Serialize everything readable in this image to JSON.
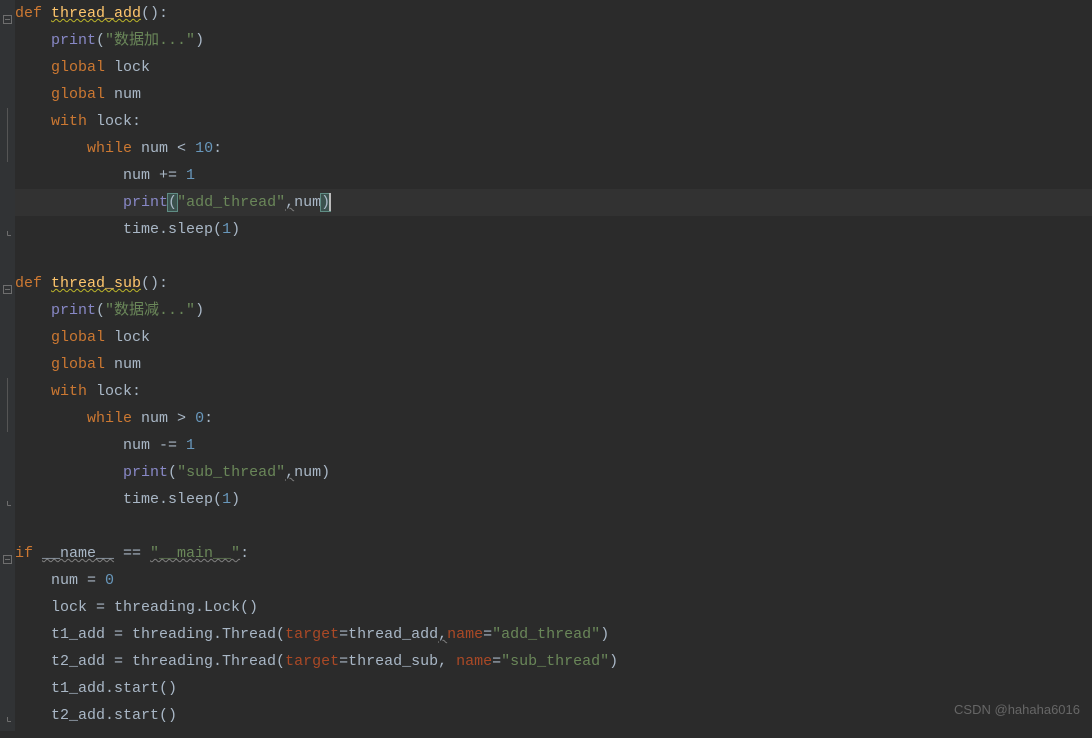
{
  "code": {
    "lines": [
      {
        "type": "def_start",
        "tokens": [
          {
            "t": "def ",
            "c": "kw"
          },
          {
            "t": "thread_add",
            "c": "fn wavy-fn"
          },
          {
            "t": "():",
            "c": "punct"
          }
        ]
      },
      {
        "indent": 1,
        "tokens": [
          {
            "t": "print",
            "c": "builtin"
          },
          {
            "t": "(",
            "c": "punct"
          },
          {
            "t": "\"数据加...\"",
            "c": "str"
          },
          {
            "t": ")",
            "c": "punct"
          }
        ]
      },
      {
        "indent": 1,
        "tokens": [
          {
            "t": "global ",
            "c": "kw"
          },
          {
            "t": "lock",
            "c": "ident"
          }
        ]
      },
      {
        "indent": 1,
        "tokens": [
          {
            "t": "global ",
            "c": "kw"
          },
          {
            "t": "num",
            "c": "ident"
          }
        ]
      },
      {
        "indent": 1,
        "tokens": [
          {
            "t": "with ",
            "c": "kw"
          },
          {
            "t": "lock:",
            "c": "ident"
          }
        ]
      },
      {
        "indent": 2,
        "tokens": [
          {
            "t": "while ",
            "c": "kw"
          },
          {
            "t": "num ",
            "c": "ident"
          },
          {
            "t": "< ",
            "c": "punct"
          },
          {
            "t": "10",
            "c": "num"
          },
          {
            "t": ":",
            "c": "punct"
          }
        ]
      },
      {
        "indent": 3,
        "tokens": [
          {
            "t": "num += ",
            "c": "ident"
          },
          {
            "t": "1",
            "c": "num"
          }
        ]
      },
      {
        "indent": 3,
        "highlight": true,
        "tokens": [
          {
            "t": "print",
            "c": "builtin"
          },
          {
            "t": "(",
            "c": "punct paren-match"
          },
          {
            "t": "\"add_thread\"",
            "c": "str"
          },
          {
            "t": ",",
            "c": "punct wavy"
          },
          {
            "t": "num",
            "c": "ident"
          },
          {
            "t": ")",
            "c": "punct paren-match"
          }
        ]
      },
      {
        "indent": 3,
        "tokens": [
          {
            "t": "time.sleep(",
            "c": "ident"
          },
          {
            "t": "1",
            "c": "num"
          },
          {
            "t": ")",
            "c": "punct"
          }
        ]
      },
      {
        "blank": true
      },
      {
        "type": "def_start",
        "tokens": [
          {
            "t": "def ",
            "c": "kw"
          },
          {
            "t": "thread_sub",
            "c": "fn wavy-fn"
          },
          {
            "t": "():",
            "c": "punct"
          }
        ]
      },
      {
        "indent": 1,
        "tokens": [
          {
            "t": "print",
            "c": "builtin"
          },
          {
            "t": "(",
            "c": "punct"
          },
          {
            "t": "\"数据减...\"",
            "c": "str"
          },
          {
            "t": ")",
            "c": "punct"
          }
        ]
      },
      {
        "indent": 1,
        "tokens": [
          {
            "t": "global ",
            "c": "kw"
          },
          {
            "t": "lock",
            "c": "ident"
          }
        ]
      },
      {
        "indent": 1,
        "tokens": [
          {
            "t": "global ",
            "c": "kw"
          },
          {
            "t": "num",
            "c": "ident"
          }
        ]
      },
      {
        "indent": 1,
        "tokens": [
          {
            "t": "with ",
            "c": "kw"
          },
          {
            "t": "lock:",
            "c": "ident"
          }
        ]
      },
      {
        "indent": 2,
        "tokens": [
          {
            "t": "while ",
            "c": "kw"
          },
          {
            "t": "num ",
            "c": "ident"
          },
          {
            "t": "> ",
            "c": "punct"
          },
          {
            "t": "0",
            "c": "num"
          },
          {
            "t": ":",
            "c": "punct"
          }
        ]
      },
      {
        "indent": 3,
        "tokens": [
          {
            "t": "num -= ",
            "c": "ident"
          },
          {
            "t": "1",
            "c": "num"
          }
        ]
      },
      {
        "indent": 3,
        "tokens": [
          {
            "t": "print",
            "c": "builtin"
          },
          {
            "t": "(",
            "c": "punct"
          },
          {
            "t": "\"sub_thread\"",
            "c": "str"
          },
          {
            "t": ",",
            "c": "punct wavy"
          },
          {
            "t": "num)",
            "c": "ident"
          }
        ]
      },
      {
        "indent": 3,
        "tokens": [
          {
            "t": "time.sleep(",
            "c": "ident"
          },
          {
            "t": "1",
            "c": "num"
          },
          {
            "t": ")",
            "c": "punct"
          }
        ]
      },
      {
        "blank": true
      },
      {
        "type": "if_start",
        "tokens": [
          {
            "t": "if ",
            "c": "kw"
          },
          {
            "t": "__name__",
            "c": "ident wavy"
          },
          {
            "t": " == ",
            "c": "punct"
          },
          {
            "t": "\"__main__\"",
            "c": "str wavy"
          },
          {
            "t": ":",
            "c": "punct"
          }
        ]
      },
      {
        "indent": 1,
        "tokens": [
          {
            "t": "num = ",
            "c": "ident"
          },
          {
            "t": "0",
            "c": "num"
          }
        ]
      },
      {
        "indent": 1,
        "tokens": [
          {
            "t": "lock = threading.Lock()",
            "c": "ident"
          }
        ]
      },
      {
        "indent": 1,
        "tokens": [
          {
            "t": "t1_add = threading.Thread(",
            "c": "ident"
          },
          {
            "t": "target",
            "c": "param"
          },
          {
            "t": "=thread_add",
            "c": "ident"
          },
          {
            "t": ",",
            "c": "punct wavy"
          },
          {
            "t": "name",
            "c": "param"
          },
          {
            "t": "=",
            "c": "punct"
          },
          {
            "t": "\"add_thread\"",
            "c": "str"
          },
          {
            "t": ")",
            "c": "punct"
          }
        ]
      },
      {
        "indent": 1,
        "tokens": [
          {
            "t": "t2_add = threading.Thread(",
            "c": "ident"
          },
          {
            "t": "target",
            "c": "param"
          },
          {
            "t": "=thread_sub, ",
            "c": "ident"
          },
          {
            "t": "name",
            "c": "param"
          },
          {
            "t": "=",
            "c": "punct"
          },
          {
            "t": "\"sub_thread\"",
            "c": "str"
          },
          {
            "t": ")",
            "c": "punct"
          }
        ]
      },
      {
        "indent": 1,
        "tokens": [
          {
            "t": "t1_add.start()",
            "c": "ident"
          }
        ]
      },
      {
        "indent": 1,
        "tokens": [
          {
            "t": "t2_add.start()",
            "c": "ident"
          }
        ]
      }
    ]
  },
  "fold_markers": [
    {
      "line": 0,
      "type": "minus"
    },
    {
      "line": 4,
      "type": "bar"
    },
    {
      "line": 5,
      "type": "bar"
    },
    {
      "line": 8,
      "type": "close"
    },
    {
      "line": 10,
      "type": "minus"
    },
    {
      "line": 14,
      "type": "bar"
    },
    {
      "line": 15,
      "type": "bar"
    },
    {
      "line": 18,
      "type": "close"
    },
    {
      "line": 20,
      "type": "minus"
    },
    {
      "line": 26,
      "type": "close"
    }
  ],
  "watermark": "CSDN @hahaha6016"
}
